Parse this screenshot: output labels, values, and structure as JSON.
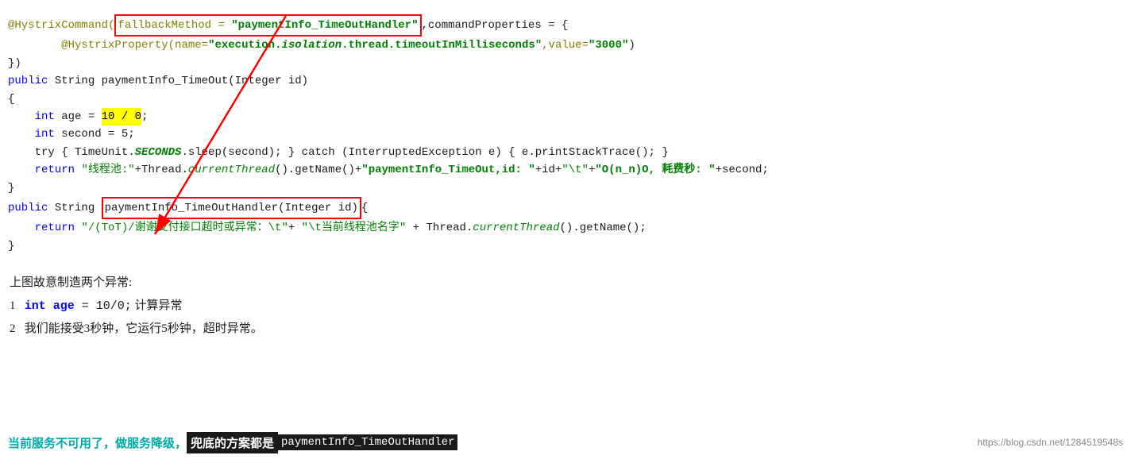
{
  "code": {
    "line1": "@HystrixCommand(",
    "line1_fallback_label": "fallbackMethod = \"paymentInfo_TimeOutHandler\"",
    "line1_rest": ",commandProperties = {",
    "line2_indent": "        ",
    "line2": "@HystrixProperty(name=\"execution.isolation.thread.timeoutInMilliseconds\",value=\"3000\")",
    "line3": "})",
    "line4": "public String paymentInfo_TimeOut(Integer id)",
    "line5": "{",
    "line6_indent": "    ",
    "line6": "int age = ",
    "line6_highlight": "10 / 0",
    "line6_end": ";",
    "line7_indent": "    ",
    "line7": "int second = 5;",
    "line8_indent": "    ",
    "line8": "try { TimeUnit.",
    "line8_italic": "SECONDS",
    "line8_rest": ".sleep(second); } catch (InterruptedException e) { e.printStackTrace(); }",
    "line9_indent": "    ",
    "line9_return": "return ",
    "line9_str1": "\"线程池:\"",
    "line9_rest1": "+Thread.",
    "line9_italic1": "currentThread",
    "line9_rest2": "().getName()+",
    "line9_str2": "\"paymentInfo_TimeOut,id: \"",
    "line9_rest3": "+id+",
    "line9_str3": "\"\\t\"",
    "line9_rest4": "+",
    "line9_str4": "\"O(n_n)O, 耗费秒: \"",
    "line9_rest5": "+second;",
    "line10": "}",
    "line11": "public String ",
    "line11_handler": "paymentInfo_TimeOutHandler(Integer id)",
    "line11_end": "{",
    "line12_indent": "    ",
    "line12_return": "return ",
    "line12_str1": "\"/（ToT）/谢谢支付接口超时或异常：\\t\"",
    "line12_rest1": "+ ",
    "line12_str2": "\"\\t当前线程池名字\"",
    "line12_rest2": " + Thread.",
    "line12_italic": "currentThread",
    "line12_rest3": "().getName();",
    "line13": "}"
  },
  "description": {
    "heading": "上图故意制造两个异常:",
    "item1_num": "1",
    "item1_code": "int age",
    "item1_eq": " = 10/0;",
    "item1_text": " 计算异常",
    "item2_num": "2",
    "item2_text": "我们能接受3秒钟，它运行5秒钟，超时异常。"
  },
  "bottom": {
    "text1": "当前服务不可用了，做服务降级，",
    "text2_label": "兜底的方案都是",
    "text2_code": "paymentInfo_TimeOutHandler",
    "url": "https://blog.csdn.net/1284519548s"
  }
}
